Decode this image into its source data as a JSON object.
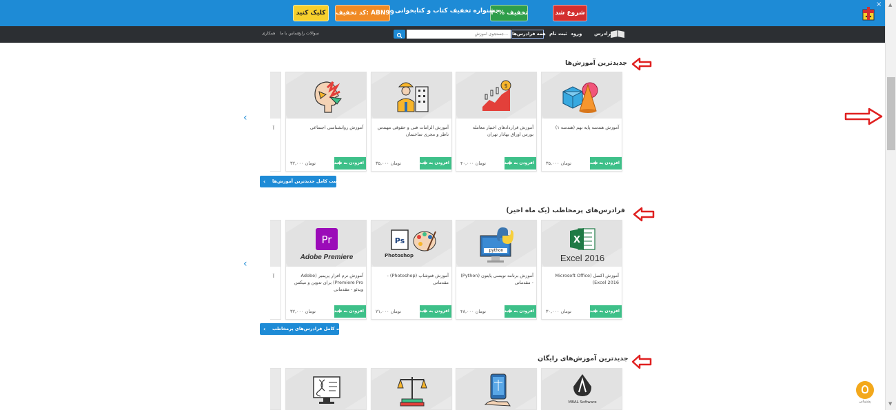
{
  "promo": {
    "start_label": "شروع شد",
    "discount_label": "۴۰% تخفیف",
    "headline": "جشنواره تخفیف کتاب و کتابخوانی",
    "code_label": "کد تخفیف: ABN99",
    "click_label": "کلیک کنید",
    "close_glyph": "×",
    "accent_color": "#1e8bd6"
  },
  "nav": {
    "brand": "فرادرس",
    "login": "ورود",
    "signup": "ثبت نام",
    "all_courses": "همه فرادرس‌ها",
    "search_placeholder": "جستجوی آموزش...",
    "links": [
      "سوالات رایج",
      "تماس با ما",
      "همکاری"
    ]
  },
  "sections": [
    {
      "title": "جدیدترین آموزش‌ها",
      "full_list_label": "فهرست کامل جدیدترین آموزش‌ها",
      "partial_fragment": "آ",
      "partial_price": "",
      "cards": [
        {
          "icon": "geometry-shapes-icon",
          "title": "آموزش هندسه پایه نهم (هندسه ۱)",
          "price": "۳۵,۰۰۰ تومان",
          "add_label": "افزودن به سبد"
        },
        {
          "icon": "stock-chart-icon",
          "title": "آموزش قراردادهای اختیار معامله بورس اوراق بهادار تهران",
          "price": "۴۰,۰۰۰ تومان",
          "add_label": "افزودن به سبد"
        },
        {
          "icon": "engineer-building-icon",
          "title": "آموزش الزامات فنی و حقوقی مهندس ناظر و مجری ساختمان",
          "price": "۳۵,۰۰۰ تومان",
          "add_label": "افزودن به سبد"
        },
        {
          "icon": "head-psychology-icon",
          "title": "آموزش روانشناسی اجتماعی",
          "price": "۳۲,۰۰۰ تومان",
          "add_label": "افزودن به سبد"
        }
      ]
    },
    {
      "title": "فرادرس‌های پرمخاطب (یک ماه اخیر)",
      "full_list_label": "فهرست کامل فرادرس‌های پرمخاطب",
      "partial_fragment": "آ",
      "partial_price": "",
      "cards": [
        {
          "icon": "excel-icon",
          "icon_text": "Excel 2016",
          "title": "آموزش اکسل (Microsoft Office Excel 2016)",
          "price": "۳۰,۰۰۰ تومان",
          "add_label": "افزودن به سبد"
        },
        {
          "icon": "python-icon",
          "icon_text": "python",
          "title": "آموزش برنامه نویسی پایتون (Python) - مقدماتی",
          "price": "۴۸,۰۰۰ تومان",
          "add_label": "افزودن به سبد"
        },
        {
          "icon": "photoshop-icon",
          "icon_text": "Photoshop",
          "title": "آموزش فتوشاپ (Photoshop) - مقدماتی",
          "price": "۲۱,۰۰۰ تومان",
          "add_label": "افزودن به سبد"
        },
        {
          "icon": "premiere-icon",
          "icon_text": "Adobe Premiere",
          "title": "آموزش نرم افزار پریمیر (Adobe Premiere Pro) برای تدوین و میکس ویدئو - مقدماتی",
          "price": "۳۲,۰۰۰ تومان",
          "add_label": "افزودن به سبد"
        }
      ]
    },
    {
      "title": "جدیدترین آموزش‌های رایگان",
      "cards": [
        {
          "icon": "mbal-logo-icon",
          "icon_text": "MBAL Software"
        },
        {
          "icon": "phone-scale-icon"
        },
        {
          "icon": "law-scale-books-icon"
        },
        {
          "icon": "dna-screen-icon"
        }
      ]
    }
  ],
  "chat": {
    "label": "پشتیبانی"
  }
}
